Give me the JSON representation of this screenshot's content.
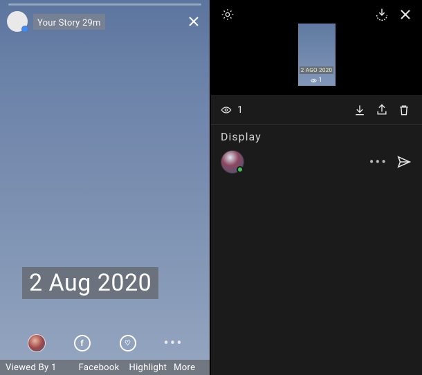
{
  "left": {
    "header": "Your Story 29m",
    "date_overlay": "2 Aug 2020",
    "bottom": {
      "viewed_by": "Viewed By 1",
      "facebook": "Facebook",
      "highlight": "Highlight",
      "more": "More"
    },
    "icons": {
      "avatar": "user-avatar",
      "facebook": "facebook-icon",
      "highlight": "highlight-icon",
      "more": "more-icon"
    }
  },
  "right": {
    "thumb_date": "2 AGO 2020",
    "thumb_views": "1",
    "viewers_count": "1",
    "section_label": "Display"
  }
}
